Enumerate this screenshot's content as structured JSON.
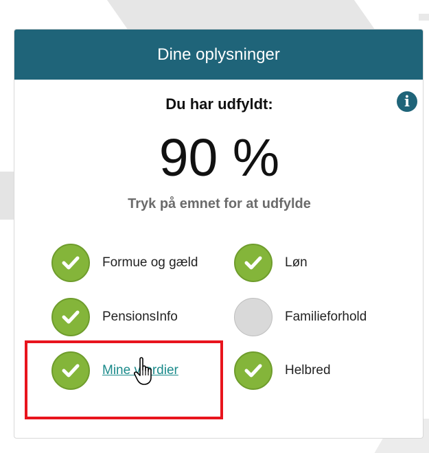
{
  "card": {
    "title": "Dine oplysninger",
    "filled_label": "Du har udfyldt:",
    "percent_text": "90 %",
    "hint": "Tryk på emnet for at udfylde",
    "info_icon": "info-icon"
  },
  "items": [
    {
      "label": "Formue og gæld",
      "status": "done"
    },
    {
      "label": "Løn",
      "status": "done"
    },
    {
      "label": "PensionsInfo",
      "status": "done"
    },
    {
      "label": "Familieforhold",
      "status": "todo"
    },
    {
      "label": "Mine værdier",
      "status": "done"
    },
    {
      "label": "Helbred",
      "status": "done"
    }
  ],
  "colors": {
    "header": "#1f6479",
    "done": "#84b53a",
    "todo": "#d9d9d9",
    "link": "#1a8a8a",
    "highlight": "#e8141d"
  },
  "icons": {
    "done": "check-icon",
    "todo": "empty-circle-icon",
    "cursor": "hand-pointer-cursor-icon"
  }
}
